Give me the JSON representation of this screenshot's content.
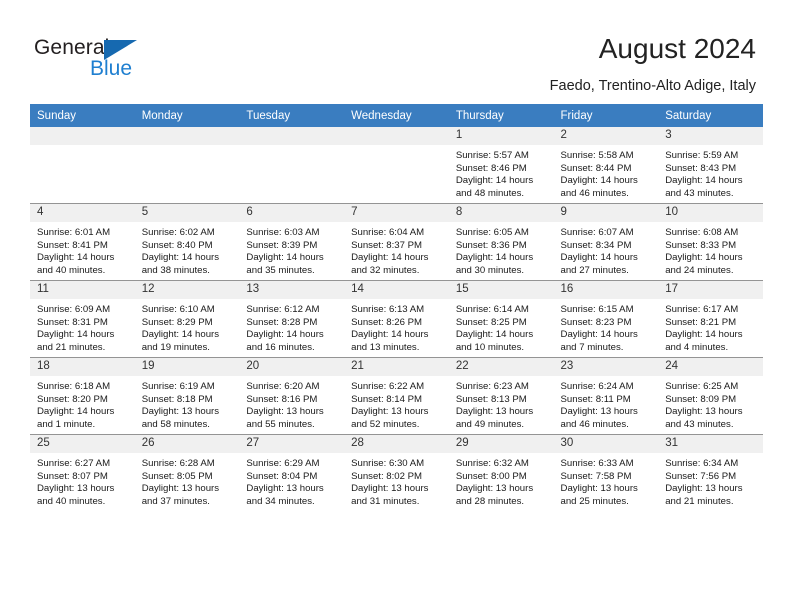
{
  "brand": {
    "name_top": "General",
    "name_bottom": "Blue",
    "accent_color": "#1f7fd0",
    "triangle_color": "#1669b0"
  },
  "header": {
    "title": "August 2024",
    "location": "Faedo, Trentino-Alto Adige, Italy",
    "header_bg": "#3a7dc0",
    "header_text_color": "#ffffff"
  },
  "weekdays": [
    "Sunday",
    "Monday",
    "Tuesday",
    "Wednesday",
    "Thursday",
    "Friday",
    "Saturday"
  ],
  "labels": {
    "sunrise": "Sunrise:",
    "sunset": "Sunset:",
    "daylight": "Daylight:"
  },
  "weeks": [
    [
      {
        "day": "",
        "empty": true
      },
      {
        "day": "",
        "empty": true
      },
      {
        "day": "",
        "empty": true
      },
      {
        "day": "",
        "empty": true
      },
      {
        "day": "1",
        "sunrise": "Sunrise: 5:57 AM",
        "sunset": "Sunset: 8:46 PM",
        "daylight_1": "Daylight: 14 hours",
        "daylight_2": "and 48 minutes."
      },
      {
        "day": "2",
        "sunrise": "Sunrise: 5:58 AM",
        "sunset": "Sunset: 8:44 PM",
        "daylight_1": "Daylight: 14 hours",
        "daylight_2": "and 46 minutes."
      },
      {
        "day": "3",
        "sunrise": "Sunrise: 5:59 AM",
        "sunset": "Sunset: 8:43 PM",
        "daylight_1": "Daylight: 14 hours",
        "daylight_2": "and 43 minutes."
      }
    ],
    [
      {
        "day": "4",
        "sunrise": "Sunrise: 6:01 AM",
        "sunset": "Sunset: 8:41 PM",
        "daylight_1": "Daylight: 14 hours",
        "daylight_2": "and 40 minutes."
      },
      {
        "day": "5",
        "sunrise": "Sunrise: 6:02 AM",
        "sunset": "Sunset: 8:40 PM",
        "daylight_1": "Daylight: 14 hours",
        "daylight_2": "and 38 minutes."
      },
      {
        "day": "6",
        "sunrise": "Sunrise: 6:03 AM",
        "sunset": "Sunset: 8:39 PM",
        "daylight_1": "Daylight: 14 hours",
        "daylight_2": "and 35 minutes."
      },
      {
        "day": "7",
        "sunrise": "Sunrise: 6:04 AM",
        "sunset": "Sunset: 8:37 PM",
        "daylight_1": "Daylight: 14 hours",
        "daylight_2": "and 32 minutes."
      },
      {
        "day": "8",
        "sunrise": "Sunrise: 6:05 AM",
        "sunset": "Sunset: 8:36 PM",
        "daylight_1": "Daylight: 14 hours",
        "daylight_2": "and 30 minutes."
      },
      {
        "day": "9",
        "sunrise": "Sunrise: 6:07 AM",
        "sunset": "Sunset: 8:34 PM",
        "daylight_1": "Daylight: 14 hours",
        "daylight_2": "and 27 minutes."
      },
      {
        "day": "10",
        "sunrise": "Sunrise: 6:08 AM",
        "sunset": "Sunset: 8:33 PM",
        "daylight_1": "Daylight: 14 hours",
        "daylight_2": "and 24 minutes."
      }
    ],
    [
      {
        "day": "11",
        "sunrise": "Sunrise: 6:09 AM",
        "sunset": "Sunset: 8:31 PM",
        "daylight_1": "Daylight: 14 hours",
        "daylight_2": "and 21 minutes."
      },
      {
        "day": "12",
        "sunrise": "Sunrise: 6:10 AM",
        "sunset": "Sunset: 8:29 PM",
        "daylight_1": "Daylight: 14 hours",
        "daylight_2": "and 19 minutes."
      },
      {
        "day": "13",
        "sunrise": "Sunrise: 6:12 AM",
        "sunset": "Sunset: 8:28 PM",
        "daylight_1": "Daylight: 14 hours",
        "daylight_2": "and 16 minutes."
      },
      {
        "day": "14",
        "sunrise": "Sunrise: 6:13 AM",
        "sunset": "Sunset: 8:26 PM",
        "daylight_1": "Daylight: 14 hours",
        "daylight_2": "and 13 minutes."
      },
      {
        "day": "15",
        "sunrise": "Sunrise: 6:14 AM",
        "sunset": "Sunset: 8:25 PM",
        "daylight_1": "Daylight: 14 hours",
        "daylight_2": "and 10 minutes."
      },
      {
        "day": "16",
        "sunrise": "Sunrise: 6:15 AM",
        "sunset": "Sunset: 8:23 PM",
        "daylight_1": "Daylight: 14 hours",
        "daylight_2": "and 7 minutes."
      },
      {
        "day": "17",
        "sunrise": "Sunrise: 6:17 AM",
        "sunset": "Sunset: 8:21 PM",
        "daylight_1": "Daylight: 14 hours",
        "daylight_2": "and 4 minutes."
      }
    ],
    [
      {
        "day": "18",
        "sunrise": "Sunrise: 6:18 AM",
        "sunset": "Sunset: 8:20 PM",
        "daylight_1": "Daylight: 14 hours",
        "daylight_2": "and 1 minute."
      },
      {
        "day": "19",
        "sunrise": "Sunrise: 6:19 AM",
        "sunset": "Sunset: 8:18 PM",
        "daylight_1": "Daylight: 13 hours",
        "daylight_2": "and 58 minutes."
      },
      {
        "day": "20",
        "sunrise": "Sunrise: 6:20 AM",
        "sunset": "Sunset: 8:16 PM",
        "daylight_1": "Daylight: 13 hours",
        "daylight_2": "and 55 minutes."
      },
      {
        "day": "21",
        "sunrise": "Sunrise: 6:22 AM",
        "sunset": "Sunset: 8:14 PM",
        "daylight_1": "Daylight: 13 hours",
        "daylight_2": "and 52 minutes."
      },
      {
        "day": "22",
        "sunrise": "Sunrise: 6:23 AM",
        "sunset": "Sunset: 8:13 PM",
        "daylight_1": "Daylight: 13 hours",
        "daylight_2": "and 49 minutes."
      },
      {
        "day": "23",
        "sunrise": "Sunrise: 6:24 AM",
        "sunset": "Sunset: 8:11 PM",
        "daylight_1": "Daylight: 13 hours",
        "daylight_2": "and 46 minutes."
      },
      {
        "day": "24",
        "sunrise": "Sunrise: 6:25 AM",
        "sunset": "Sunset: 8:09 PM",
        "daylight_1": "Daylight: 13 hours",
        "daylight_2": "and 43 minutes."
      }
    ],
    [
      {
        "day": "25",
        "sunrise": "Sunrise: 6:27 AM",
        "sunset": "Sunset: 8:07 PM",
        "daylight_1": "Daylight: 13 hours",
        "daylight_2": "and 40 minutes."
      },
      {
        "day": "26",
        "sunrise": "Sunrise: 6:28 AM",
        "sunset": "Sunset: 8:05 PM",
        "daylight_1": "Daylight: 13 hours",
        "daylight_2": "and 37 minutes."
      },
      {
        "day": "27",
        "sunrise": "Sunrise: 6:29 AM",
        "sunset": "Sunset: 8:04 PM",
        "daylight_1": "Daylight: 13 hours",
        "daylight_2": "and 34 minutes."
      },
      {
        "day": "28",
        "sunrise": "Sunrise: 6:30 AM",
        "sunset": "Sunset: 8:02 PM",
        "daylight_1": "Daylight: 13 hours",
        "daylight_2": "and 31 minutes."
      },
      {
        "day": "29",
        "sunrise": "Sunrise: 6:32 AM",
        "sunset": "Sunset: 8:00 PM",
        "daylight_1": "Daylight: 13 hours",
        "daylight_2": "and 28 minutes."
      },
      {
        "day": "30",
        "sunrise": "Sunrise: 6:33 AM",
        "sunset": "Sunset: 7:58 PM",
        "daylight_1": "Daylight: 13 hours",
        "daylight_2": "and 25 minutes."
      },
      {
        "day": "31",
        "sunrise": "Sunrise: 6:34 AM",
        "sunset": "Sunset: 7:56 PM",
        "daylight_1": "Daylight: 13 hours",
        "daylight_2": "and 21 minutes."
      }
    ]
  ]
}
